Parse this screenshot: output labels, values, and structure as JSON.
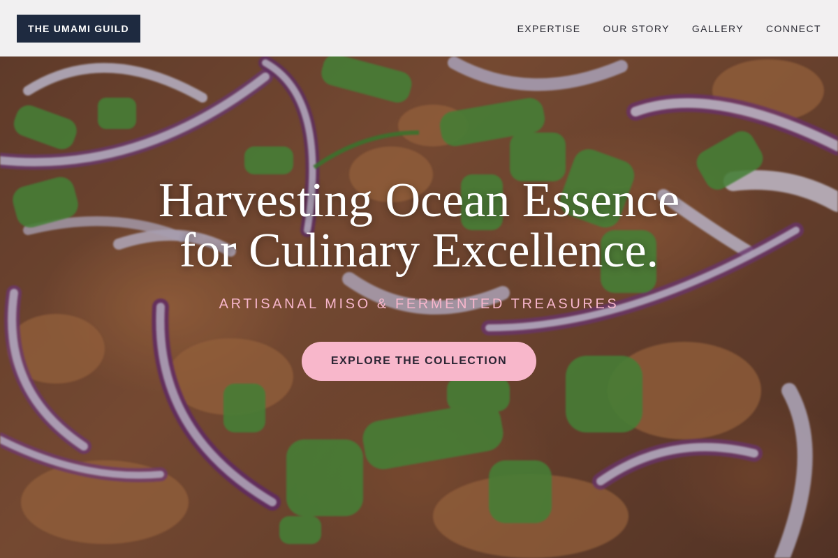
{
  "header": {
    "logo": "THE UMAMI GUILD",
    "nav": [
      {
        "label": "EXPERTISE"
      },
      {
        "label": "OUR STORY"
      },
      {
        "label": "GALLERY"
      },
      {
        "label": "CONNECT"
      }
    ]
  },
  "hero": {
    "title_line1": "Harvesting Ocean Essence",
    "title_line2": "for Culinary Excellence.",
    "subtitle": "ARTISANAL MISO & FERMENTED TREASURES",
    "cta_label": "EXPLORE THE COLLECTION"
  },
  "colors": {
    "logo_bg": "#1e2a40",
    "accent_pink": "#f8b7cb",
    "subtitle_pink": "#f7b6cc",
    "header_bg": "#f8f8fa"
  }
}
